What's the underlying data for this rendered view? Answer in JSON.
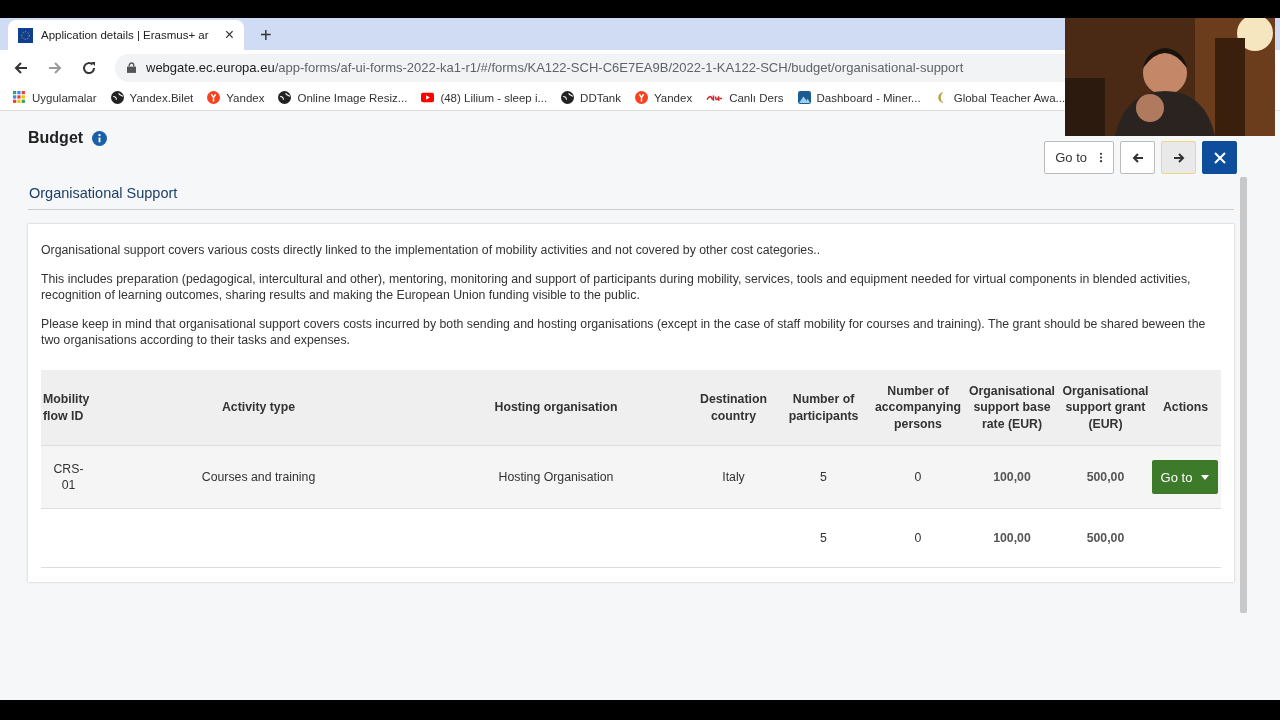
{
  "browser": {
    "tab": {
      "title": "Application details | Erasmus+ ar",
      "close": "×"
    },
    "new_tab": "+",
    "address": {
      "host": "webgate.ec.europa.eu",
      "path": "/app-forms/af-ui-forms-2022-ka1-r1/#/forms/KA122-SCH-C6E7EA9B/2022-1-KA122-SCH/budget/organisational-support"
    },
    "bookmarks": [
      {
        "kind": "apps",
        "label": "Uygulamalar"
      },
      {
        "kind": "globe",
        "label": "Yandex.Bilet"
      },
      {
        "kind": "yandex",
        "label": "Yandex"
      },
      {
        "kind": "globe",
        "label": "Online Image Resiz..."
      },
      {
        "kind": "video",
        "label": "(48) Lilium - sleep i..."
      },
      {
        "kind": "globe",
        "label": "DDTank"
      },
      {
        "kind": "yandex",
        "label": "Yandex"
      },
      {
        "kind": "edu",
        "label": "Canlı Ders"
      },
      {
        "kind": "mountain",
        "label": "Dashboard - Miner..."
      },
      {
        "kind": "moon",
        "label": "Global Teacher Awa..."
      }
    ]
  },
  "page": {
    "title": "Budget",
    "goto_button": "Go to",
    "section_title": "Organisational Support",
    "paragraphs": [
      "Organisational support covers various costs directly linked to the implementation of mobility activities and not covered by other cost categories..",
      "This includes preparation (pedagogical, intercultural and other), mentoring, monitoring and support of participants during mobility, services, tools and equipment needed for virtual components in blended activities, recognition of learning outcomes, sharing results and making the European Union funding visible to the public.",
      "Please keep in mind that organisational support covers costs incurred by both sending and hosting organisations (except in the case of staff mobility for courses and training). The grant should be shared beween the two organisations according to their tasks and expenses."
    ],
    "table": {
      "columns": [
        "Mobility flow ID",
        "Activity type",
        "Hosting organisation",
        "Destination country",
        "Number of participants",
        "Number of accompanying persons",
        "Organisational support base rate (EUR)",
        "Organisational support grant (EUR)",
        "Actions"
      ],
      "rows": [
        {
          "cells": [
            "CRS-01",
            "Courses and training",
            "Hosting Organisation",
            "Italy",
            "5",
            "0",
            "100,00",
            "500,00"
          ],
          "action": "Go to"
        }
      ],
      "totals": {
        "participants": "5",
        "accompanying": "0",
        "base_rate": "100,00",
        "grant": "500,00"
      }
    }
  }
}
